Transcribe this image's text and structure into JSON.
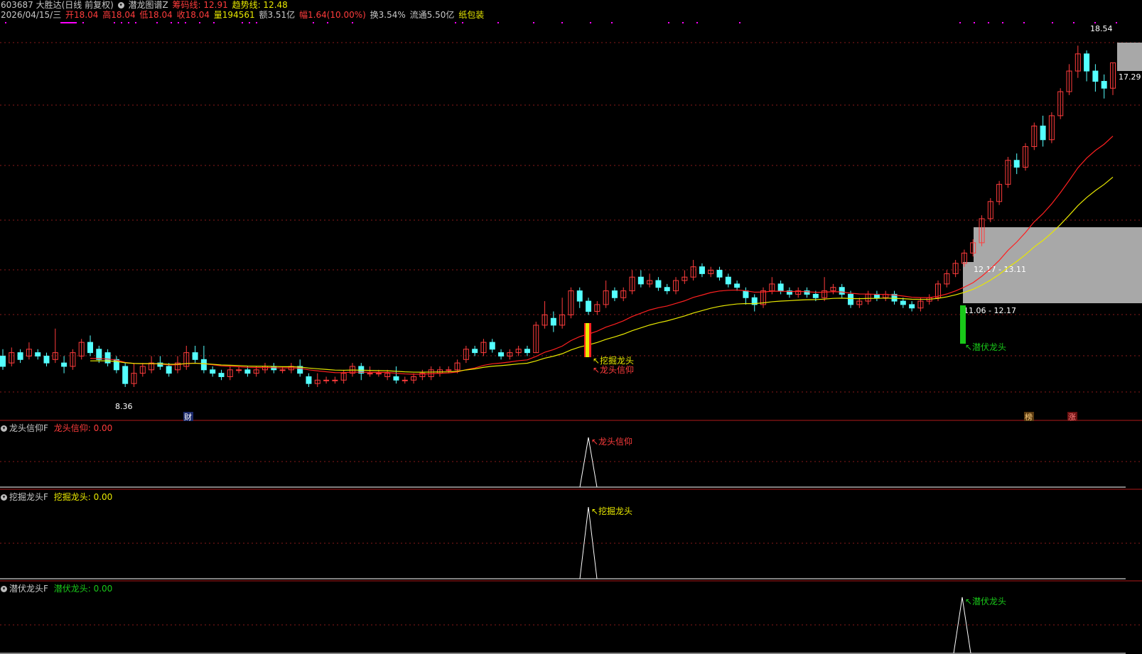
{
  "header": {
    "code_name": "603687 大胜达(日线 前复权)",
    "indicator_name": "潜龙图谱Z",
    "chip_line_label": "筹码线: 12.91",
    "trend_line_label": "趋势线: 12.48",
    "date": "2026/04/15/三",
    "open": "开18.04",
    "high": "高18.04",
    "low": "低18.04",
    "close": "收18.04",
    "volume": "量194561",
    "amount": "额3.51亿",
    "change": "幅1.64(10.00%)",
    "turnover": "换3.54%",
    "float": "流通5.50亿",
    "concept": "纸包装"
  },
  "colors": {
    "up": "#ff3c3c",
    "down": "#54ffff",
    "chip_line": "#ff2020",
    "trend_line": "#e8e800",
    "grid": "#8a1a1a",
    "zone": "#a8a8a8",
    "dots": "#ff00ff"
  },
  "main_chart": {
    "price_labels": {
      "max": "18.54",
      "right": "17.29",
      "min": "8.36"
    },
    "zones": [
      {
        "label": "",
        "low": 13.11,
        "high": 13.85
      },
      {
        "label": "12.17 - 13.11",
        "low": 12.17,
        "high": 13.11
      },
      {
        "label": "11.06 - 12.17",
        "low": 11.06,
        "high": 12.17
      }
    ],
    "signals": {
      "dig": "挖掘龙头",
      "faith": "龙头信仰",
      "hidden": "潜伏龙头"
    },
    "markers": {
      "cai": "财",
      "bang": "榜",
      "zhang": "涨"
    }
  },
  "panes": [
    {
      "id": "faith",
      "title": "龙头信仰F",
      "value_label": "龙头信仰: 0.00",
      "signal": "龙头信仰",
      "color": "#ff3c3c"
    },
    {
      "id": "dig",
      "title": "挖掘龙头F",
      "value_label": "挖掘龙头: 0.00",
      "signal": "挖掘龙头",
      "color": "#e8e800"
    },
    {
      "id": "hidden",
      "title": "潜伏龙头F",
      "value_label": "潜伏龙头: 0.00",
      "signal": "潜伏龙头",
      "color": "#19c819"
    }
  ],
  "chart_data": {
    "type": "candlestick",
    "ylim": [
      8.0,
      19.0
    ],
    "candles": [
      [
        9.5,
        9.2,
        9.7,
        9.1
      ],
      [
        9.3,
        9.6,
        9.75,
        9.2
      ],
      [
        9.6,
        9.4,
        9.7,
        9.3
      ],
      [
        9.5,
        9.7,
        9.9,
        9.4
      ],
      [
        9.6,
        9.5,
        9.7,
        9.4
      ],
      [
        9.5,
        9.3,
        9.6,
        9.2
      ],
      [
        9.4,
        9.6,
        10.3,
        9.3
      ],
      [
        9.3,
        9.2,
        9.5,
        9.0
      ],
      [
        9.2,
        9.6,
        9.7,
        9.1
      ],
      [
        9.5,
        9.9,
        10.0,
        9.4
      ],
      [
        9.9,
        9.6,
        10.1,
        9.5
      ],
      [
        9.7,
        9.4,
        9.8,
        9.3
      ],
      [
        9.6,
        9.3,
        9.7,
        9.2
      ],
      [
        9.4,
        9.1,
        9.5,
        9.0
      ],
      [
        9.2,
        8.7,
        9.3,
        8.6
      ],
      [
        8.7,
        9.0,
        9.3,
        8.6
      ],
      [
        9.0,
        9.2,
        9.3,
        8.9
      ],
      [
        9.1,
        9.3,
        9.5,
        9.0
      ],
      [
        9.3,
        9.2,
        9.5,
        9.1
      ],
      [
        9.2,
        9.0,
        9.3,
        8.9
      ],
      [
        9.1,
        9.3,
        9.5,
        9.0
      ],
      [
        9.2,
        9.6,
        9.8,
        9.1
      ],
      [
        9.6,
        9.4,
        9.8,
        9.3
      ],
      [
        9.4,
        9.1,
        9.8,
        9.0
      ],
      [
        9.1,
        9.0,
        9.2,
        8.9
      ],
      [
        9.0,
        8.9,
        9.1,
        8.8
      ],
      [
        8.9,
        9.1,
        9.2,
        8.8
      ],
      [
        9.1,
        9.1,
        9.2,
        9.0
      ],
      [
        9.1,
        9.0,
        9.2,
        8.9
      ],
      [
        9.0,
        9.1,
        9.2,
        8.9
      ],
      [
        9.1,
        9.2,
        9.3,
        9.0
      ],
      [
        9.2,
        9.1,
        9.3,
        9.0
      ],
      [
        9.1,
        9.1,
        9.2,
        9.0
      ],
      [
        9.1,
        9.2,
        9.3,
        9.0
      ],
      [
        9.2,
        9.0,
        9.4,
        8.9
      ],
      [
        8.9,
        8.7,
        9.0,
        8.6
      ],
      [
        8.7,
        8.8,
        9.0,
        8.6
      ],
      [
        8.8,
        8.8,
        8.9,
        8.7
      ],
      [
        8.8,
        8.8,
        8.9,
        8.7
      ],
      [
        8.8,
        9.0,
        9.1,
        8.7
      ],
      [
        9.0,
        9.2,
        9.3,
        8.9
      ],
      [
        9.2,
        9.0,
        9.3,
        8.8
      ],
      [
        9.0,
        9.0,
        9.2,
        8.9
      ],
      [
        9.0,
        9.0,
        9.1,
        8.9
      ],
      [
        8.9,
        9.0,
        9.1,
        8.8
      ],
      [
        8.9,
        8.8,
        9.2,
        8.7
      ],
      [
        8.8,
        8.8,
        8.9,
        8.7
      ],
      [
        8.8,
        8.9,
        9.0,
        8.7
      ],
      [
        8.9,
        9.0,
        9.1,
        8.8
      ],
      [
        8.9,
        9.1,
        9.2,
        8.8
      ],
      [
        9.0,
        9.1,
        9.2,
        8.9
      ],
      [
        9.1,
        9.1,
        9.2,
        9.0
      ],
      [
        9.1,
        9.3,
        9.4,
        9.0
      ],
      [
        9.4,
        9.7,
        9.8,
        9.3
      ],
      [
        9.7,
        9.6,
        9.8,
        9.5
      ],
      [
        9.6,
        9.9,
        10.0,
        9.5
      ],
      [
        9.9,
        9.7,
        10.0,
        9.6
      ],
      [
        9.6,
        9.5,
        9.7,
        9.4
      ],
      [
        9.5,
        9.6,
        9.7,
        9.4
      ],
      [
        9.6,
        9.7,
        9.8,
        9.5
      ],
      [
        9.7,
        9.6,
        9.8,
        9.5
      ],
      [
        9.6,
        10.4,
        10.5,
        9.6
      ],
      [
        10.4,
        10.7,
        11.1,
        10.3
      ],
      [
        10.6,
        10.4,
        10.8,
        10.2
      ],
      [
        10.4,
        10.7,
        11.2,
        10.3
      ],
      [
        10.7,
        11.4,
        11.5,
        10.6
      ],
      [
        11.4,
        11.1,
        11.5,
        10.9
      ],
      [
        11.1,
        10.8,
        11.2,
        10.7
      ],
      [
        10.8,
        11.0,
        11.1,
        10.7
      ],
      [
        11.0,
        11.4,
        11.7,
        10.9
      ],
      [
        11.4,
        11.2,
        11.5,
        11.1
      ],
      [
        11.2,
        11.4,
        11.5,
        11.1
      ],
      [
        11.4,
        11.8,
        12.0,
        11.3
      ],
      [
        11.8,
        11.6,
        12.0,
        11.5
      ],
      [
        11.6,
        11.7,
        11.9,
        11.5
      ],
      [
        11.7,
        11.5,
        11.8,
        11.4
      ],
      [
        11.5,
        11.4,
        11.6,
        11.3
      ],
      [
        11.4,
        11.7,
        11.8,
        11.3
      ],
      [
        11.7,
        11.8,
        12.0,
        11.6
      ],
      [
        11.8,
        12.1,
        12.3,
        11.7
      ],
      [
        12.1,
        11.9,
        12.2,
        11.8
      ],
      [
        11.9,
        12.0,
        12.1,
        11.8
      ],
      [
        12.0,
        11.8,
        12.1,
        11.7
      ],
      [
        11.8,
        11.6,
        11.9,
        11.5
      ],
      [
        11.6,
        11.5,
        11.7,
        11.4
      ],
      [
        11.4,
        11.2,
        11.5,
        11.0
      ],
      [
        11.2,
        11.0,
        11.3,
        10.8
      ],
      [
        11.0,
        11.4,
        11.5,
        10.9
      ],
      [
        11.4,
        11.6,
        11.8,
        11.3
      ],
      [
        11.6,
        11.4,
        11.7,
        11.3
      ],
      [
        11.4,
        11.3,
        11.5,
        11.2
      ],
      [
        11.3,
        11.4,
        11.5,
        11.2
      ],
      [
        11.4,
        11.3,
        11.5,
        11.2
      ],
      [
        11.3,
        11.2,
        11.4,
        11.1
      ],
      [
        11.2,
        11.4,
        11.8,
        11.1
      ],
      [
        11.4,
        11.5,
        11.6,
        11.3
      ],
      [
        11.5,
        11.3,
        11.6,
        11.2
      ],
      [
        11.3,
        11.0,
        11.4,
        10.9
      ],
      [
        11.0,
        11.1,
        11.2,
        10.9
      ],
      [
        11.1,
        11.3,
        11.4,
        11.0
      ],
      [
        11.3,
        11.2,
        11.4,
        11.1
      ],
      [
        11.2,
        11.3,
        11.4,
        11.1
      ],
      [
        11.3,
        11.1,
        11.4,
        11.0
      ],
      [
        11.1,
        11.0,
        11.2,
        10.9
      ],
      [
        11.0,
        10.9,
        11.1,
        10.8
      ],
      [
        10.9,
        11.1,
        11.2,
        10.8
      ],
      [
        11.1,
        11.2,
        11.3,
        11.0
      ],
      [
        11.2,
        11.6,
        11.7,
        11.1
      ],
      [
        11.6,
        11.9,
        12.0,
        11.5
      ],
      [
        11.9,
        12.2,
        12.3,
        11.8
      ],
      [
        12.2,
        12.5,
        12.6,
        12.1
      ],
      [
        12.5,
        12.8,
        12.9,
        12.4
      ],
      [
        12.8,
        13.5,
        13.6,
        12.7
      ],
      [
        13.5,
        14.0,
        14.1,
        13.4
      ],
      [
        14.0,
        14.5,
        14.6,
        13.9
      ],
      [
        14.5,
        15.2,
        15.3,
        14.4
      ],
      [
        15.2,
        15.0,
        15.4,
        14.8
      ],
      [
        15.0,
        15.6,
        15.7,
        14.9
      ],
      [
        15.6,
        16.2,
        16.3,
        15.5
      ],
      [
        16.2,
        15.8,
        16.5,
        15.6
      ],
      [
        15.8,
        16.5,
        16.6,
        15.7
      ],
      [
        16.5,
        17.2,
        17.3,
        16.4
      ],
      [
        17.2,
        17.8,
        18.0,
        17.1
      ],
      [
        17.8,
        18.3,
        18.54,
        17.6
      ],
      [
        18.3,
        17.8,
        18.4,
        17.5
      ],
      [
        17.8,
        17.5,
        18.0,
        17.2
      ],
      [
        17.5,
        17.3,
        17.7,
        17.0
      ],
      [
        17.3,
        18.04,
        18.04,
        17.1
      ]
    ],
    "signal_dates": [
      "挖掘龙头",
      "龙头信仰",
      "潜伏龙头"
    ]
  }
}
